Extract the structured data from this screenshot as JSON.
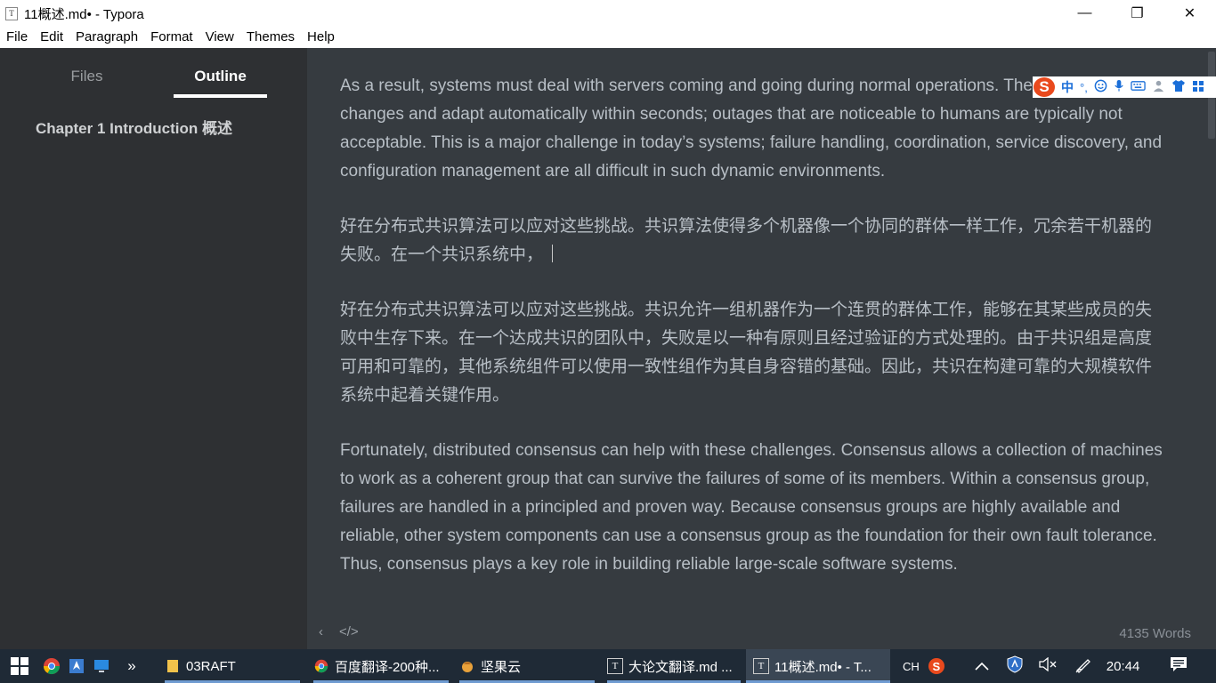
{
  "window": {
    "title": "11概述.md• - Typora",
    "app_icon": "T",
    "minimize_glyph": "—",
    "maximize_glyph": "❐",
    "close_glyph": "✕"
  },
  "menu": [
    "File",
    "Edit",
    "Paragraph",
    "Format",
    "View",
    "Themes",
    "Help"
  ],
  "sidebar": {
    "tabs": [
      "Files",
      "Outline"
    ],
    "active_tab": "Outline",
    "outline_items": [
      "Chapter 1 Introduction 概述"
    ]
  },
  "editor": {
    "paragraphs": [
      "As a result, systems must deal with servers coming and going during normal operations. They must react to changes and adapt automatically within seconds; outages that are noticeable to humans are typically not acceptable. This is a major challenge in today’s systems; failure handling, coordination, service discovery, and configuration management are all difficult in such dynamic environments.",
      "好在分布式共识算法可以应对这些挑战。共识算法使得多个机器像一个协同的群体一样工作，冗余若干机器的失败。在一个共识系统中，",
      "好在分布式共识算法可以应对这些挑战。共识允许一组机器作为一个连贯的群体工作，能够在其某些成员的失败中生存下来。在一个达成共识的团队中，失败是以一种有原则且经过验证的方式处理的。由于共识组是高度可用和可靠的，其他系统组件可以使用一致性组作为其自身容错的基础。因此，共识在构建可靠的大规模软件系统中起着关键作用。",
      "Fortunately, distributed consensus can help with these challenges. Consensus allows a collection of machines to work as a coherent group that can survive the failures of some of its members. Within a consensus group, failures are handled in a principled and proven way. Because consensus groups are highly available and reliable, other system components can use a consensus group as the foundation for their own fault tolerance. Thus, consensus plays a key role in building reliable large-scale software systems."
    ],
    "footer_left": [
      "‹",
      "</>"
    ],
    "word_count": "4135 Words"
  },
  "ime": {
    "logo": "S",
    "mode": "中",
    "punct": "°,",
    "icons": [
      "emoji-icon",
      "mic-icon",
      "keyboard-icon",
      "user-icon",
      "shirt-icon",
      "grid-icon"
    ],
    "accent": "#1a6ed8",
    "brand": "#e9491d"
  },
  "taskbar": {
    "tasks": [
      {
        "label": "03RAFT",
        "icon": "folder-icon"
      },
      {
        "label": "百度翻译-200种...",
        "icon": "chrome-icon"
      },
      {
        "label": "坚果云",
        "icon": "nutstore-icon"
      },
      {
        "label": "大论文翻译.md ...",
        "icon": "typora-icon"
      },
      {
        "label": "11概述.md• - T...",
        "icon": "typora-icon"
      }
    ],
    "overflow": "»",
    "ime_indicator": "CH",
    "clock": "20:44"
  },
  "colors": {
    "sidebar_bg": "#2E3033",
    "editor_bg": "#363B40",
    "text": "#B8BFC6",
    "taskbar_bg": "#1f2a36"
  }
}
